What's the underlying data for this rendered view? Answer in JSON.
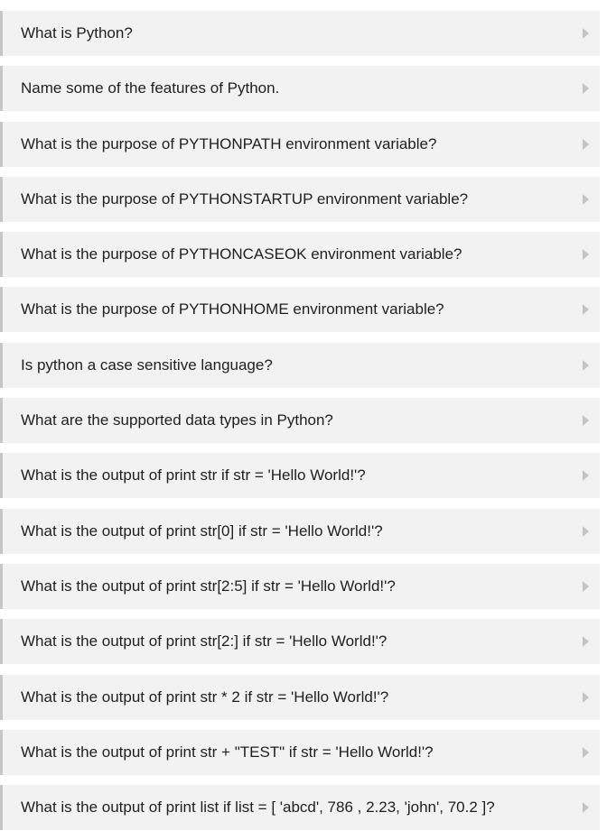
{
  "faq": {
    "items": [
      {
        "question": "What is Python?"
      },
      {
        "question": "Name some of the features of Python."
      },
      {
        "question": "What is the purpose of PYTHONPATH environment variable?"
      },
      {
        "question": "What is the purpose of PYTHONSTARTUP environment variable?"
      },
      {
        "question": "What is the purpose of PYTHONCASEOK environment variable?"
      },
      {
        "question": "What is the purpose of PYTHONHOME environment variable?"
      },
      {
        "question": "Is python a case sensitive language?"
      },
      {
        "question": "What are the supported data types in Python?"
      },
      {
        "question": "What is the output of print str if str = 'Hello World!'?"
      },
      {
        "question": "What is the output of print str[0] if str = 'Hello World!'?"
      },
      {
        "question": "What is the output of print str[2:5] if str = 'Hello World!'?"
      },
      {
        "question": "What is the output of print str[2:] if str = 'Hello World!'?"
      },
      {
        "question": "What is the output of print str * 2 if str = 'Hello World!'?"
      },
      {
        "question": "What is the output of print str + \"TEST\" if str = 'Hello World!'?"
      },
      {
        "question": "What is the output of print list if list = [ 'abcd', 786 , 2.23, 'john', 70.2 ]?"
      }
    ],
    "expand_icon": "caret-right-icon"
  }
}
